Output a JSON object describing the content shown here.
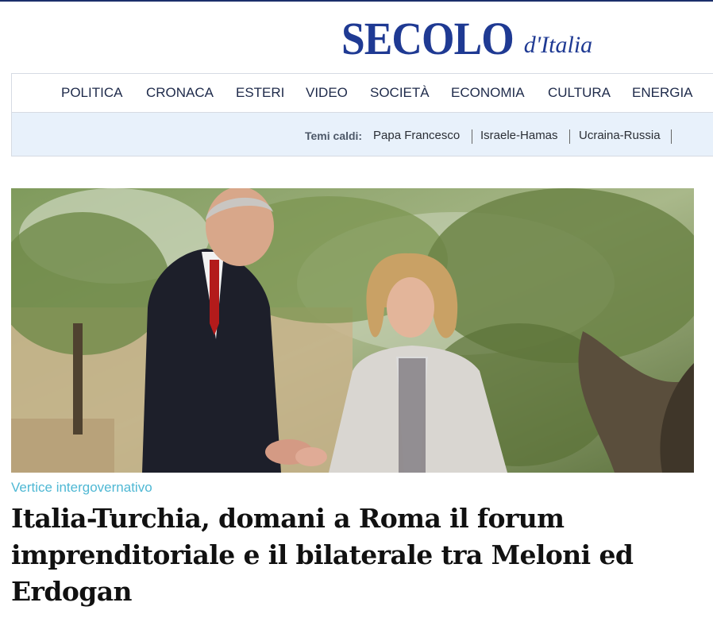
{
  "brand": {
    "name": "SECOLO",
    "suffix": "d'Italia",
    "color": "#1f3a93"
  },
  "nav": {
    "items": [
      "POLITICA",
      "CRONACA",
      "ESTERI",
      "VIDEO",
      "SOCIETÀ",
      "ECONOMIA",
      "CULTURA",
      "ENERGIA"
    ]
  },
  "hot_topics": {
    "label": "Temi caldi:",
    "links": [
      "Papa Francesco",
      "Israele-Hamas",
      "Ucraina-Russia"
    ]
  },
  "article": {
    "kicker": "Vertice intergovernativo",
    "kicker_color": "#4fb8d4",
    "headline": "Italia-Turchia, domani a Roma il forum imprenditoriale e il bilaterale tra Meloni ed Erdogan"
  }
}
